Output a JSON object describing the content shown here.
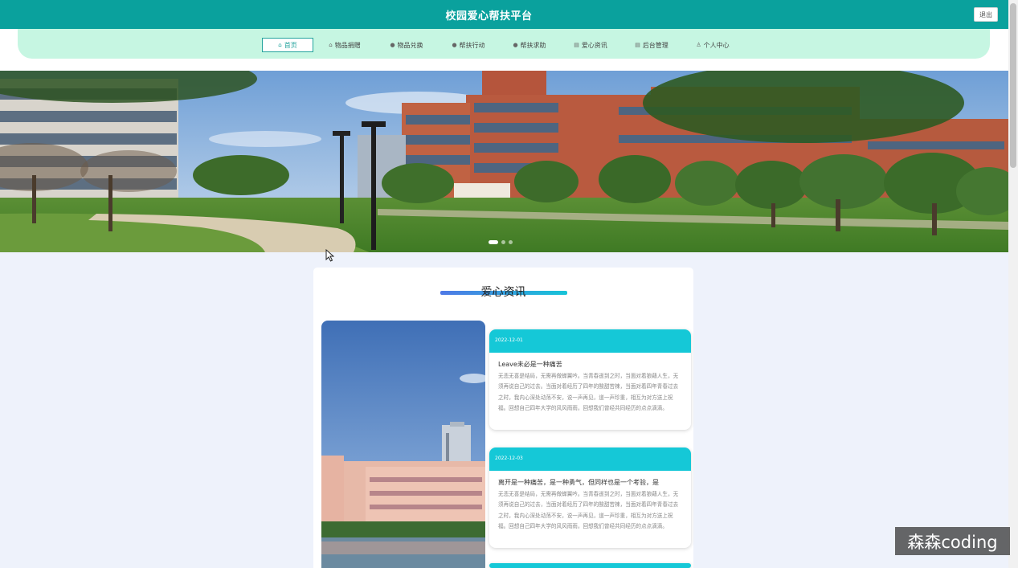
{
  "header": {
    "title": "校园爱心帮扶平台",
    "logout_label": "退出"
  },
  "nav": {
    "items": [
      {
        "label": "首页",
        "icon": "home-icon",
        "glyph": "⌂",
        "active": true
      },
      {
        "label": "物品捐赠",
        "icon": "gift-icon",
        "glyph": "⌂"
      },
      {
        "label": "物品兑换",
        "icon": "exchange-icon",
        "glyph": "●"
      },
      {
        "label": "帮扶行动",
        "icon": "help-icon",
        "glyph": "●"
      },
      {
        "label": "帮扶求助",
        "icon": "request-icon",
        "glyph": "●"
      },
      {
        "label": "爱心资讯",
        "icon": "news-icon",
        "glyph": "▤"
      },
      {
        "label": "后台管理",
        "icon": "admin-icon",
        "glyph": "▤"
      },
      {
        "label": "个人中心",
        "icon": "user-icon",
        "glyph": "♙"
      }
    ]
  },
  "carousel": {
    "slide_count": 3,
    "active_index": 0
  },
  "news": {
    "section_title": "爱心资讯",
    "items": [
      {
        "date": "2022-12-01",
        "title": "Leave未必是一种痛苦",
        "summary": "无悲无喜是结局，无需再做蝉翼吟。当青春逝到之时，当面对着狼藉人生，无须再说自己的过去。当面对着经历了四年的酸甜苦辣，当面对着四年青春过去之时，我内心深处动荡不安，说一声再见，道一声珍重，相互为对方送上祝福。回想自己四年大学的风风雨雨，回想我们曾经共同经历的点点滴滴。"
      },
      {
        "date": "2022-12-03",
        "title": "离开是一种痛苦，是一种勇气，但同样也是一个考验，是",
        "summary": "无悲无喜是结局，无需再做蝉翼吟。当青春逝到之时，当面对着狼藉人生，无须再说自己的过去，当面对着经历了四年的酸甜苦辣，当面对着四年青春过去之时，我内心深处动荡不安，说一声再见，道一声珍重，相互为对方送上祝福。回想自己四年大学的风风雨雨，回想我们曾经共同经历的点点滴滴。"
      }
    ]
  },
  "watermark": "森森coding"
}
